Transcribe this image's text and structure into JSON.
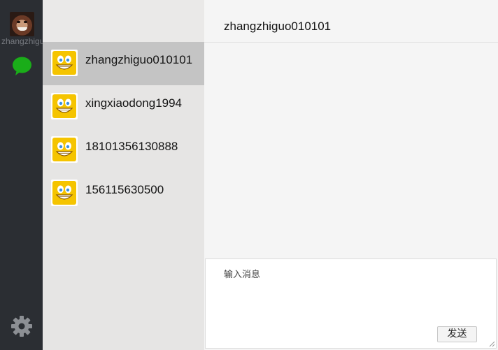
{
  "user": {
    "name": "zhangzhiguo010101"
  },
  "contacts": [
    {
      "name": "zhangzhiguo010101",
      "active": true
    },
    {
      "name": "xingxiaodong1994",
      "active": false
    },
    {
      "name": "18101356130888",
      "active": false
    },
    {
      "name": "156115630500",
      "active": false
    }
  ],
  "chat": {
    "title": "zhangzhiguo010101",
    "input_placeholder": "输入消息",
    "send_label": "发送"
  },
  "icons": {
    "chat": "chat-bubble-icon",
    "settings": "gear-icon",
    "contact_avatar": "smiley-face-icon"
  },
  "colors": {
    "rail": "#2b2e33",
    "chat_icon": "#1aad19",
    "active_contact": "#c4c4c4"
  }
}
